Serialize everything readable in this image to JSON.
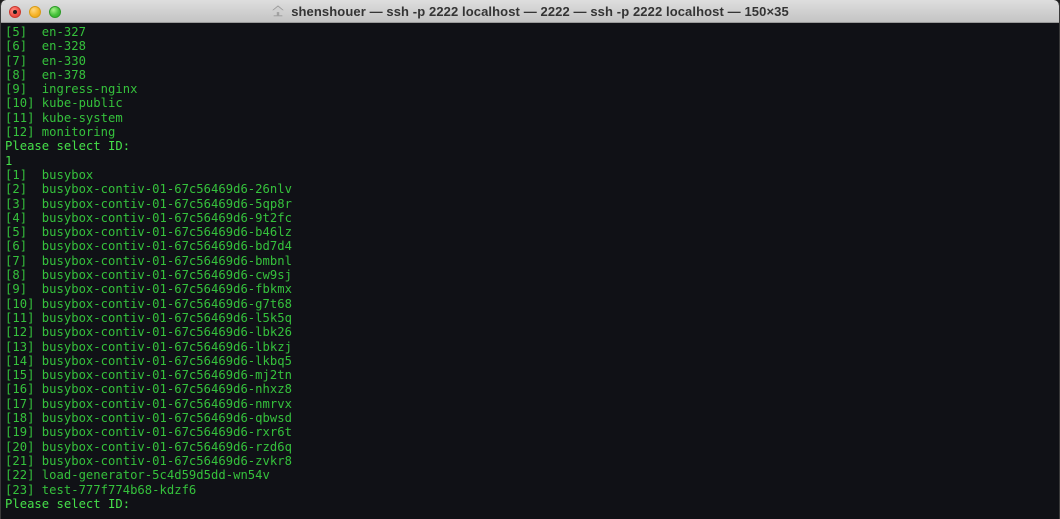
{
  "window": {
    "title": "shenshouer — ssh -p 2222 localhost — 2222 — ssh -p 2222 localhost — 150×35",
    "title_icon": "home-icon",
    "controls": {
      "close_label": "close",
      "minimize_label": "minimize",
      "maximize_label": "maximize"
    }
  },
  "colors": {
    "terminal_background": "#101116",
    "list_text": "#35c13c",
    "prompt_text": "#46e04a",
    "titlebar_text": "#343434",
    "close_button": "#ef5349",
    "minimize_button": "#f7b429",
    "maximize_button": "#45c13a"
  },
  "terminal": {
    "lines": [
      {
        "text": "[5]  en-327",
        "kind": "list"
      },
      {
        "text": "[6]  en-328",
        "kind": "list"
      },
      {
        "text": "[7]  en-330",
        "kind": "list"
      },
      {
        "text": "[8]  en-378",
        "kind": "list"
      },
      {
        "text": "[9]  ingress-nginx",
        "kind": "list"
      },
      {
        "text": "[10] kube-public",
        "kind": "list"
      },
      {
        "text": "[11] kube-system",
        "kind": "list"
      },
      {
        "text": "[12] monitoring",
        "kind": "list"
      },
      {
        "text": "Please select ID:",
        "kind": "prompt"
      },
      {
        "text": "1",
        "kind": "input"
      },
      {
        "text": "[1]  busybox",
        "kind": "list"
      },
      {
        "text": "[2]  busybox-contiv-01-67c56469d6-26nlv",
        "kind": "list"
      },
      {
        "text": "[3]  busybox-contiv-01-67c56469d6-5qp8r",
        "kind": "list"
      },
      {
        "text": "[4]  busybox-contiv-01-67c56469d6-9t2fc",
        "kind": "list"
      },
      {
        "text": "[5]  busybox-contiv-01-67c56469d6-b46lz",
        "kind": "list"
      },
      {
        "text": "[6]  busybox-contiv-01-67c56469d6-bd7d4",
        "kind": "list"
      },
      {
        "text": "[7]  busybox-contiv-01-67c56469d6-bmbnl",
        "kind": "list"
      },
      {
        "text": "[8]  busybox-contiv-01-67c56469d6-cw9sj",
        "kind": "list"
      },
      {
        "text": "[9]  busybox-contiv-01-67c56469d6-fbkmx",
        "kind": "list"
      },
      {
        "text": "[10] busybox-contiv-01-67c56469d6-g7t68",
        "kind": "list"
      },
      {
        "text": "[11] busybox-contiv-01-67c56469d6-l5k5q",
        "kind": "list"
      },
      {
        "text": "[12] busybox-contiv-01-67c56469d6-lbk26",
        "kind": "list"
      },
      {
        "text": "[13] busybox-contiv-01-67c56469d6-lbkzj",
        "kind": "list"
      },
      {
        "text": "[14] busybox-contiv-01-67c56469d6-lkbq5",
        "kind": "list"
      },
      {
        "text": "[15] busybox-contiv-01-67c56469d6-mj2tn",
        "kind": "list"
      },
      {
        "text": "[16] busybox-contiv-01-67c56469d6-nhxz8",
        "kind": "list"
      },
      {
        "text": "[17] busybox-contiv-01-67c56469d6-nmrvx",
        "kind": "list"
      },
      {
        "text": "[18] busybox-contiv-01-67c56469d6-qbwsd",
        "kind": "list"
      },
      {
        "text": "[19] busybox-contiv-01-67c56469d6-rxr6t",
        "kind": "list"
      },
      {
        "text": "[20] busybox-contiv-01-67c56469d6-rzd6q",
        "kind": "list"
      },
      {
        "text": "[21] busybox-contiv-01-67c56469d6-zvkr8",
        "kind": "list"
      },
      {
        "text": "[22] load-generator-5c4d59d5dd-wn54v",
        "kind": "list"
      },
      {
        "text": "[23] test-777f774b68-kdzf6",
        "kind": "list"
      },
      {
        "text": "Please select ID:",
        "kind": "prompt"
      }
    ]
  }
}
